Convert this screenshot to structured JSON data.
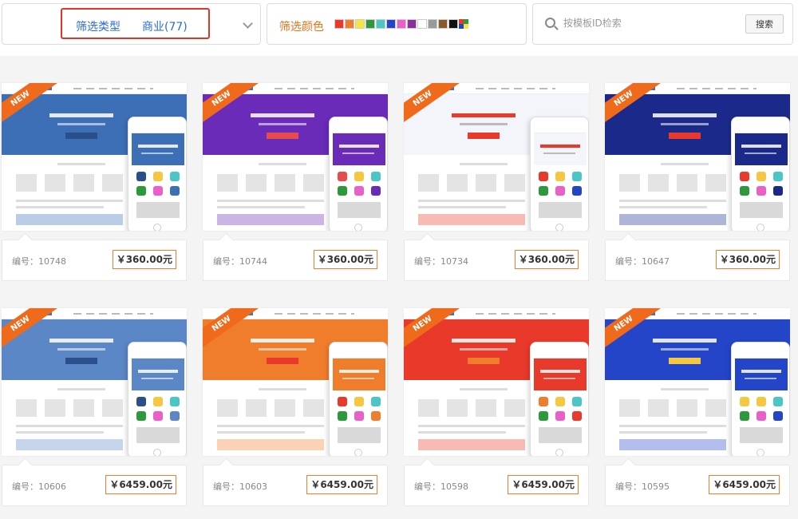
{
  "filter": {
    "type_label": "筛选类型",
    "type_value": "商业(77)",
    "color_label": "筛选颜色",
    "colors": [
      "#e8392b",
      "#f07d2c",
      "#f5e642",
      "#2c9a3a",
      "#4bc6c6",
      "#2445c8",
      "#e860c8",
      "#8e2e9c",
      "#ffffff",
      "#9a9a9a",
      "#8c5a2a",
      "#111111"
    ],
    "multi_color_icon": "multi-color-swatch-icon"
  },
  "search": {
    "placeholder": "按模板ID检索",
    "button_label": "搜索"
  },
  "badge_text": "NEW",
  "cards": [
    {
      "id_label": "编号：10748",
      "price": "￥360.00元",
      "theme": "#3d6fb6",
      "accent": "#2b4f8a"
    },
    {
      "id_label": "编号：10744",
      "price": "￥360.00元",
      "theme": "#6a2bb8",
      "accent": "#e84b4b"
    },
    {
      "id_label": "编号：10734",
      "price": "￥360.00元",
      "theme": "#ffffff",
      "accent": "#e8392b"
    },
    {
      "id_label": "编号：10647",
      "price": "￥360.00元",
      "theme": "#1b2a8a",
      "accent": "#e8392b"
    },
    {
      "id_label": "编号：10606",
      "price": "￥6459.00元",
      "theme": "#5b87c6",
      "accent": "#2b4f8a"
    },
    {
      "id_label": "编号：10603",
      "price": "￥6459.00元",
      "theme": "#f07d2c",
      "accent": "#e8392b"
    },
    {
      "id_label": "编号：10598",
      "price": "￥6459.00元",
      "theme": "#e8392b",
      "accent": "#f07d2c"
    },
    {
      "id_label": "编号：10595",
      "price": "￥6459.00元",
      "theme": "#2445c8",
      "accent": "#f5c842"
    }
  ]
}
